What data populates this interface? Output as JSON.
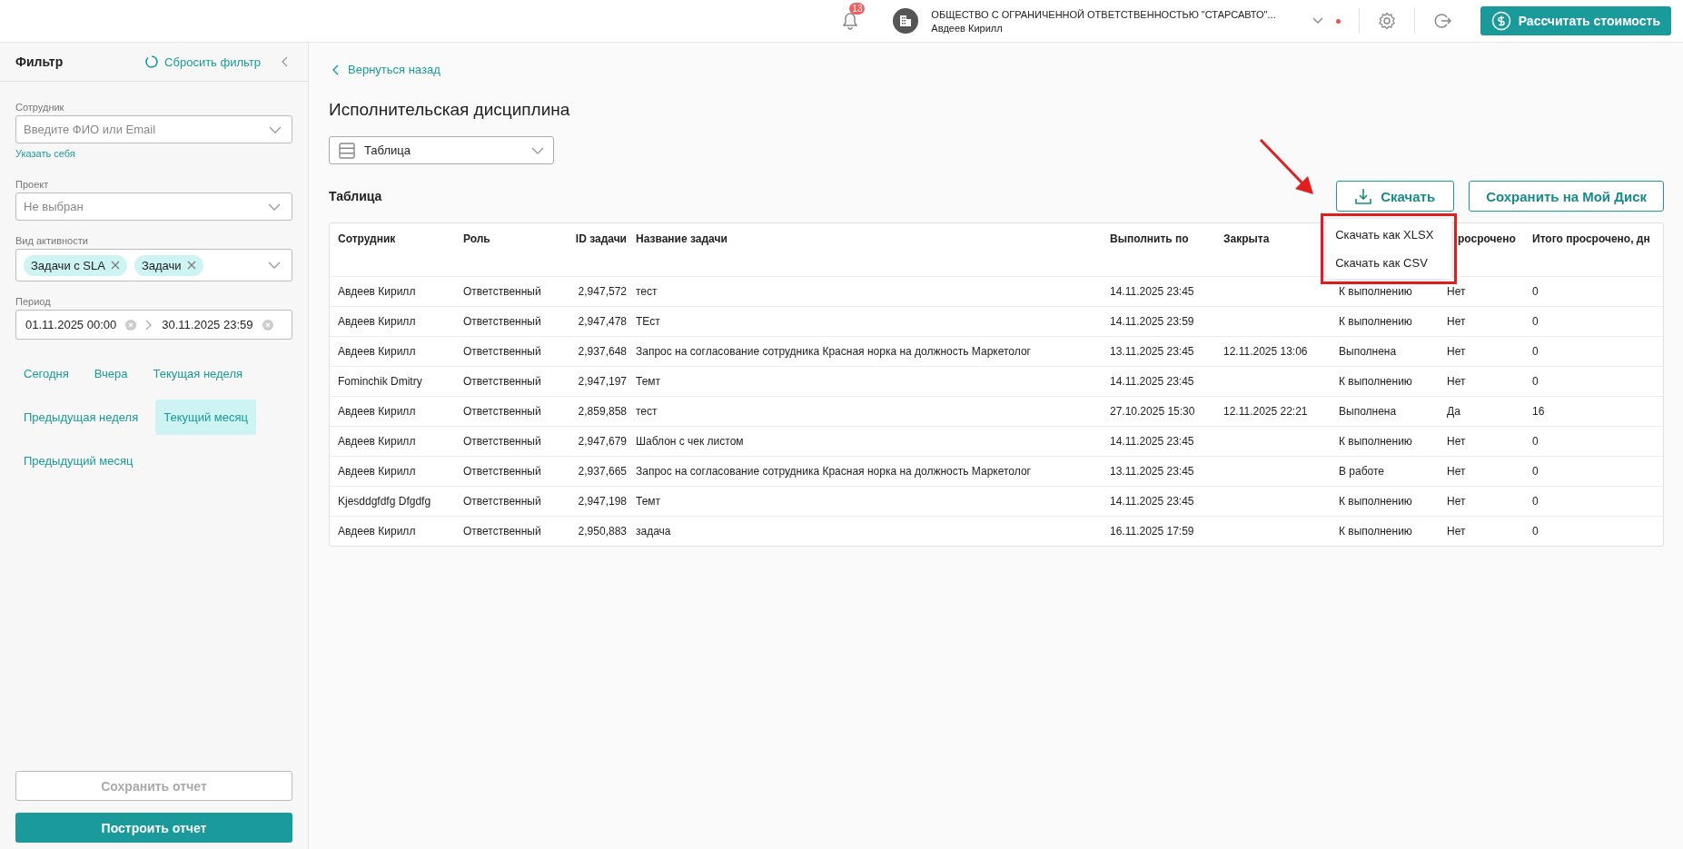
{
  "header": {
    "notifications": {
      "count": "13"
    },
    "company": "ОБЩЕСТВО С ОГРАНИЧЕННОЙ ОТВЕТСТВЕННОСТЬЮ \"СТАРСАВТО\"...",
    "user": "Авдеев Кирилл",
    "unread_dot": true,
    "calc_button": "Рассчитать стоимость"
  },
  "filter": {
    "title": "Фильтр",
    "reset": "Сбросить фильтр",
    "employee": {
      "label": "Сотрудник",
      "placeholder": "Введите ФИО или Email",
      "link": "Указать себя"
    },
    "project": {
      "label": "Проект",
      "value": "Не выбран"
    },
    "activity": {
      "label": "Вид активности",
      "chips": [
        "Задачи с SLA",
        "Задачи"
      ]
    },
    "period": {
      "label": "Период",
      "from": "01.11.2025 00:00",
      "to": "30.11.2025 23:59"
    },
    "presets": [
      [
        {
          "label": "Сегодня",
          "selected": false
        },
        {
          "label": "Вчера",
          "selected": false
        },
        {
          "label": "Текущая неделя",
          "selected": false
        }
      ],
      [
        {
          "label": "Предыдущая неделя",
          "selected": false
        },
        {
          "label": "Текущий месяц",
          "selected": true
        }
      ],
      [
        {
          "label": "Предыдущий месяц",
          "selected": false
        }
      ]
    ],
    "save_button": {
      "label": "Сохранить отчет",
      "disabled": true
    },
    "build_button": {
      "label": "Построить отчет",
      "disabled": false
    }
  },
  "main": {
    "back": "Вернуться назад",
    "title": "Исполнительская дисциплина",
    "view_select": "Таблица",
    "section_title": "Таблица",
    "download_button": "Скачать",
    "save_disk_button": "Сохранить на Мой Диск",
    "download_menu": [
      "Скачать как XLSX",
      "Скачать как CSV"
    ],
    "table": {
      "columns": [
        "Сотрудник",
        "Роль",
        "ID задачи",
        "Название задачи",
        "Выполнить по",
        "Закрыта",
        null,
        "росрочено",
        "Итого просрочено, дн"
      ],
      "rows": [
        [
          "Авдеев Кирилл",
          "Ответственный",
          "2,947,572",
          "тест",
          "14.11.2025 23:45",
          null,
          "К выполнению",
          "Нет",
          "0"
        ],
        [
          "Авдеев Кирилл",
          "Ответственный",
          "2,947,478",
          "ТЕст",
          "14.11.2025 23:59",
          null,
          "К выполнению",
          "Нет",
          "0"
        ],
        [
          "Авдеев Кирилл",
          "Ответственный",
          "2,937,648",
          "Запрос на согласование сотрудника Красная норка на должность Маркетолог",
          "13.11.2025 23:45",
          "12.11.2025 13:06",
          "Выполнена",
          "Нет",
          "0"
        ],
        [
          "Fominchik Dmitry",
          "Ответственный",
          "2,947,197",
          "Темт",
          "14.11.2025 23:45",
          null,
          "К выполнению",
          "Нет",
          "0"
        ],
        [
          "Авдеев Кирилл",
          "Ответственный",
          "2,859,858",
          "тест",
          "27.10.2025 15:30",
          "12.11.2025 22:21",
          "Выполнена",
          "Да",
          "16"
        ],
        [
          "Авдеев Кирилл",
          "Ответственный",
          "2,947,679",
          "Шаблон с чек листом",
          "14.11.2025 23:45",
          null,
          "К выполнению",
          "Нет",
          "0"
        ],
        [
          "Авдеев Кирилл",
          "Ответственный",
          "2,937,665",
          "Запрос на согласование сотрудника Красная норка на должность Маркетолог",
          "13.11.2025 23:45",
          null,
          "В работе",
          "Нет",
          "0"
        ],
        [
          "Kjesddgfdfg Dfgdfg",
          "Ответственный",
          "2,947,198",
          "Темт",
          "14.11.2025 23:45",
          null,
          "К выполнению",
          "Нет",
          "0"
        ],
        [
          "Авдеев Кирилл",
          "Ответственный",
          "2,950,883",
          "задача",
          "16.11.2025 17:59",
          null,
          "К выполнению",
          "Нет",
          "0"
        ]
      ]
    }
  }
}
